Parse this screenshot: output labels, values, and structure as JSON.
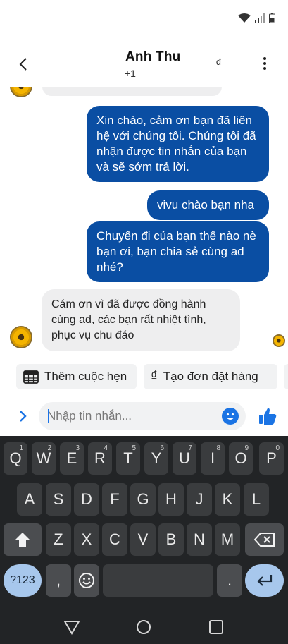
{
  "header": {
    "title": "Anh Thu",
    "subtitle": "+1",
    "currency_symbol": "₫"
  },
  "messages": [
    {
      "direction": "out",
      "text": "Xin chào, cảm ơn bạn đã liên hệ với chúng tôi. Chúng tôi đã nhận được tin nhắn của bạn và sẽ sớm trả lời."
    },
    {
      "direction": "out",
      "text": "vivu chào bạn nha"
    },
    {
      "direction": "out",
      "text": "Chuyến đi của bạn thế nào nè bạn ơi, bạn chia sẻ cùng ad nhé?"
    },
    {
      "direction": "in",
      "text": "Cám ơn vì đã được đồng hành cùng ad, các bạn rất nhiệt tình, phục vụ chu đáo"
    }
  ],
  "quick_actions": [
    {
      "label": "Thêm cuộc hẹn",
      "icon": "calendar-icon"
    },
    {
      "label": "Tạo đơn đặt hàng",
      "icon": "dong-icon",
      "symbol": "₫"
    }
  ],
  "composer": {
    "placeholder": "Nhập tin nhắn..."
  },
  "keyboard": {
    "row1": [
      {
        "key": "Q",
        "hint": "1"
      },
      {
        "key": "W",
        "hint": "2"
      },
      {
        "key": "E",
        "hint": "3"
      },
      {
        "key": "R",
        "hint": "4"
      },
      {
        "key": "T",
        "hint": "5"
      },
      {
        "key": "Y",
        "hint": "6"
      },
      {
        "key": "U",
        "hint": "7"
      },
      {
        "key": "I",
        "hint": "8"
      },
      {
        "key": "O",
        "hint": "9"
      },
      {
        "key": "P",
        "hint": "0"
      }
    ],
    "row2": [
      "A",
      "S",
      "D",
      "F",
      "G",
      "H",
      "J",
      "K",
      "L"
    ],
    "row3": [
      "Z",
      "X",
      "C",
      "V",
      "B",
      "N",
      "M"
    ],
    "symbols_label": "?123",
    "comma": ",",
    "period": "."
  },
  "colors": {
    "outgoing_bubble": "#0a4ea3",
    "incoming_bubble": "#eeeeef",
    "accent": "#1b74e4",
    "keyboard_bg": "#222426"
  }
}
